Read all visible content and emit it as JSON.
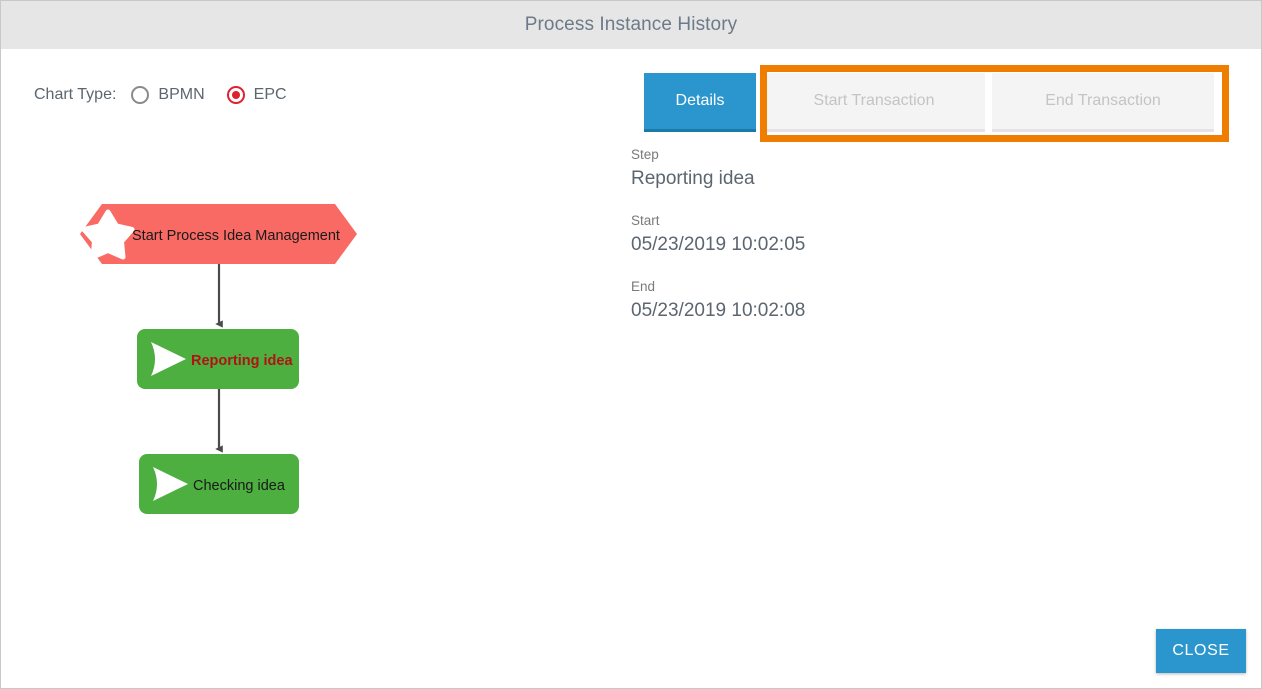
{
  "header": {
    "title": "Process Instance History"
  },
  "chart_type": {
    "label": "Chart Type:",
    "options": [
      {
        "label": "BPMN",
        "selected": false
      },
      {
        "label": "EPC",
        "selected": true
      }
    ]
  },
  "tabs": [
    {
      "label": "Details",
      "state": "active"
    },
    {
      "label": "Start Transaction",
      "state": "disabled"
    },
    {
      "label": "End Transaction",
      "state": "disabled"
    }
  ],
  "details": {
    "step_label": "Step",
    "step_value": "Reporting idea",
    "start_label": "Start",
    "start_value": "05/23/2019 10:02:05",
    "end_label": "End",
    "end_value": "05/23/2019 10:02:08"
  },
  "diagram": {
    "nodes": [
      {
        "id": "start-event",
        "shape": "hexagon",
        "label": "Start Process Idea Management",
        "fill": "#fa6a64",
        "text_color": "#1a1a1a",
        "bold": false,
        "icon": "star-icon"
      },
      {
        "id": "reporting-idea",
        "shape": "rounded-rect",
        "label": "Reporting idea",
        "fill": "#4caf40",
        "text_color": "#b01313",
        "bold": true,
        "icon": "play-triangle-icon"
      },
      {
        "id": "checking-idea",
        "shape": "rounded-rect",
        "label": "Checking idea",
        "fill": "#4caf40",
        "text_color": "#1a1a1a",
        "bold": false,
        "icon": "play-triangle-icon"
      }
    ],
    "connector_color": "#4a4a4a"
  },
  "footer": {
    "close_label": "CLOSE"
  },
  "colors": {
    "header_bg": "#e6e6e6",
    "title_text": "#6c7a89",
    "accent_blue": "#2a96cd",
    "highlight_orange": "#ef7d00",
    "radio_selected": "#e0202c",
    "node_green": "#4caf40",
    "node_red": "#fa6a64"
  }
}
